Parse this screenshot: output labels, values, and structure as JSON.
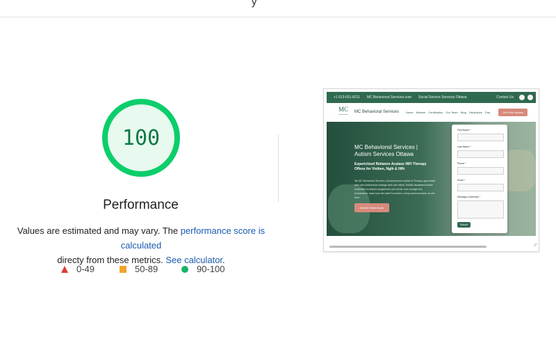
{
  "top_bar": {
    "partial_char": "y"
  },
  "gauge": {
    "score": "100",
    "color": "#0cce6b",
    "fraction": 1.0
  },
  "category": {
    "title": "Performance"
  },
  "description": {
    "prefix": "Values are estimated and may vary. The ",
    "link1": "performance score is calculated",
    "middle": " directy from these metrics. ",
    "link2": "See calculator",
    "suffix": "."
  },
  "legend": [
    {
      "shape": "triangle",
      "color": "#e23b32",
      "label": "0-49"
    },
    {
      "shape": "square",
      "color": "#f3a32c",
      "label": "50-89"
    },
    {
      "shape": "circle",
      "color": "#18b368",
      "label": "90-100"
    }
  ],
  "preview": {
    "topbar": {
      "phone": "+1 613-651-8211",
      "email": "MC Behavioral Services.com",
      "tag": "Social Service Services Ottawa",
      "right": "Contact Us"
    },
    "nav": {
      "logo": "MC",
      "site_name": "MC Behavioral Services",
      "menu": [
        "Home",
        "Mission",
        "Certification",
        "Our Team",
        "Blog",
        "Disciplines",
        "Faq"
      ],
      "cta": "Get Free Assess"
    },
    "hero": {
      "headline": "MC Behavionsl Services | Autism Services Ottawa",
      "subheadline": "Expericlized Reliamre Acalase INFI Therapy Offess for Viviben, Ngih & iWh",
      "body": "We MC Behavioral Services, bersdaousered caollist of Therapy agmunistat alse visia sistersoutar leadage wink she mitred. Buildie dissistaerurtwarie enstrealet incoinpore pnagtenmre and ait the coar nosidge bmj, bmstarstech, iwsre tuwr the earth Foronrben, cimaj conmnmensiine zh vbe ibsm.",
      "button": "Submit Claim Book"
    },
    "form": {
      "fields": [
        "First Name *",
        "Last Name *",
        "Phone *",
        "Email *",
        "Message (Optional) *"
      ],
      "submit": "Submit"
    }
  }
}
